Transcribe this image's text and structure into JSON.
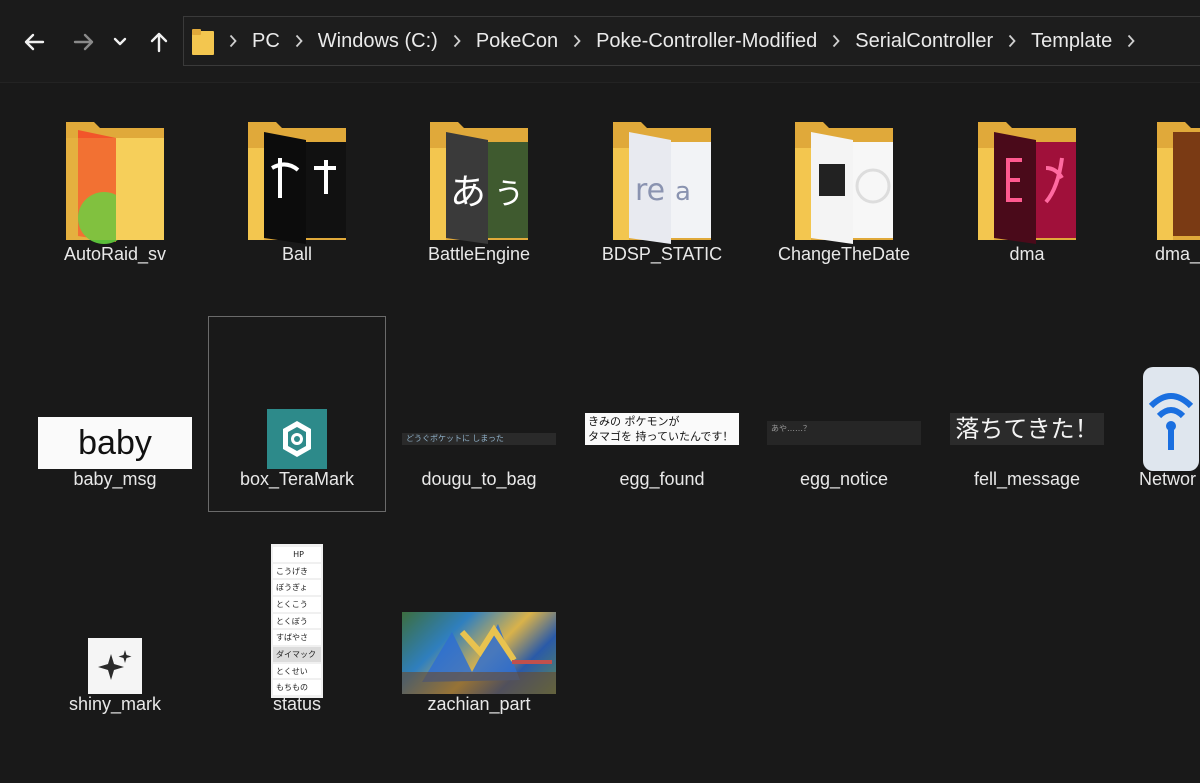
{
  "nav": {
    "back_icon": "arrow-left-icon",
    "forward_icon": "arrow-right-icon",
    "recent_icon": "chevron-down-icon",
    "up_icon": "arrow-up-icon"
  },
  "breadcrumbs": [
    "PC",
    "Windows (C:)",
    "PokeCon",
    "Poke-Controller-Modified",
    "SerialController",
    "Template"
  ],
  "items": [
    {
      "name": "AutoRaid_sv",
      "kind": "folder"
    },
    {
      "name": "Ball",
      "kind": "folder"
    },
    {
      "name": "BattleEngine",
      "kind": "folder"
    },
    {
      "name": "BDSP_STATIC",
      "kind": "folder"
    },
    {
      "name": "ChangeTheDate",
      "kind": "folder"
    },
    {
      "name": "dma",
      "kind": "folder"
    },
    {
      "name": "dma_",
      "kind": "folder"
    },
    {
      "name": "baby_msg",
      "kind": "image",
      "preview_text": "baby"
    },
    {
      "name": "box_TeraMark",
      "kind": "image",
      "selected": true
    },
    {
      "name": "dougu_to_bag",
      "kind": "image",
      "preview_text": "どうぐポケットに しまった"
    },
    {
      "name": "egg_found",
      "kind": "image",
      "preview_text": [
        "きみの ポケモンが",
        "タマゴを 持っていたんです！"
      ]
    },
    {
      "name": "egg_notice",
      "kind": "image",
      "preview_text": "あや……？"
    },
    {
      "name": "fell_message",
      "kind": "image",
      "preview_text": "落ちてきた！"
    },
    {
      "name": "Networ",
      "kind": "image"
    },
    {
      "name": "shiny_mark",
      "kind": "image"
    },
    {
      "name": "status",
      "kind": "image",
      "preview_text": [
        "HP",
        "こうげき",
        "ぼうぎょ",
        "とくこう",
        "とくぼう",
        "すばやさ",
        "ダイマック",
        "とくせい",
        "もちもの"
      ]
    },
    {
      "name": "zachian_part",
      "kind": "image"
    }
  ],
  "colors": {
    "folder": "#f3c64f",
    "folder_back": "#e0a93a",
    "background": "#191919",
    "tera": "#2d8a8a"
  }
}
